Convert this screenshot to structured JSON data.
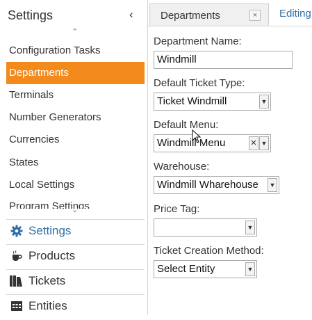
{
  "sidebar": {
    "title": "Settings",
    "collapse_glyph": "‹",
    "scroll_up_glyph": "⌃",
    "scroll_down_glyph": "⌄",
    "items": [
      {
        "label": "Configuration Tasks"
      },
      {
        "label": "Departments",
        "active": true
      },
      {
        "label": "Terminals"
      },
      {
        "label": "Number Generators"
      },
      {
        "label": "Currencies"
      },
      {
        "label": "States"
      },
      {
        "label": "Local Settings"
      },
      {
        "label": "Program Settings"
      }
    ],
    "sections": [
      {
        "label": "Settings",
        "icon": "gear-icon"
      },
      {
        "label": "Products",
        "icon": "coffee-cup-icon"
      },
      {
        "label": "Tickets",
        "icon": "books-icon"
      },
      {
        "label": "Entities",
        "icon": "table-icon"
      }
    ]
  },
  "tabs": {
    "departments": "Departments",
    "close_glyph": "×",
    "editing": "Editing"
  },
  "form": {
    "department_name": {
      "label": "Department Name:",
      "value": "Windmill"
    },
    "ticket_type": {
      "label": "Default Ticket Type:",
      "value": "Ticket Windmill"
    },
    "menu": {
      "label": "Default Menu:",
      "value": "Windmill Menu"
    },
    "warehouse": {
      "label": "Warehouse:",
      "value": "Windmill Wharehouse"
    },
    "price_tag": {
      "label": "Price Tag:",
      "value": ""
    },
    "ticket_creation": {
      "label": "Ticket Creation Method:",
      "value": "Select Entity"
    }
  },
  "colors": {
    "accent": "#f28b1c",
    "link": "#2f6ea8"
  }
}
